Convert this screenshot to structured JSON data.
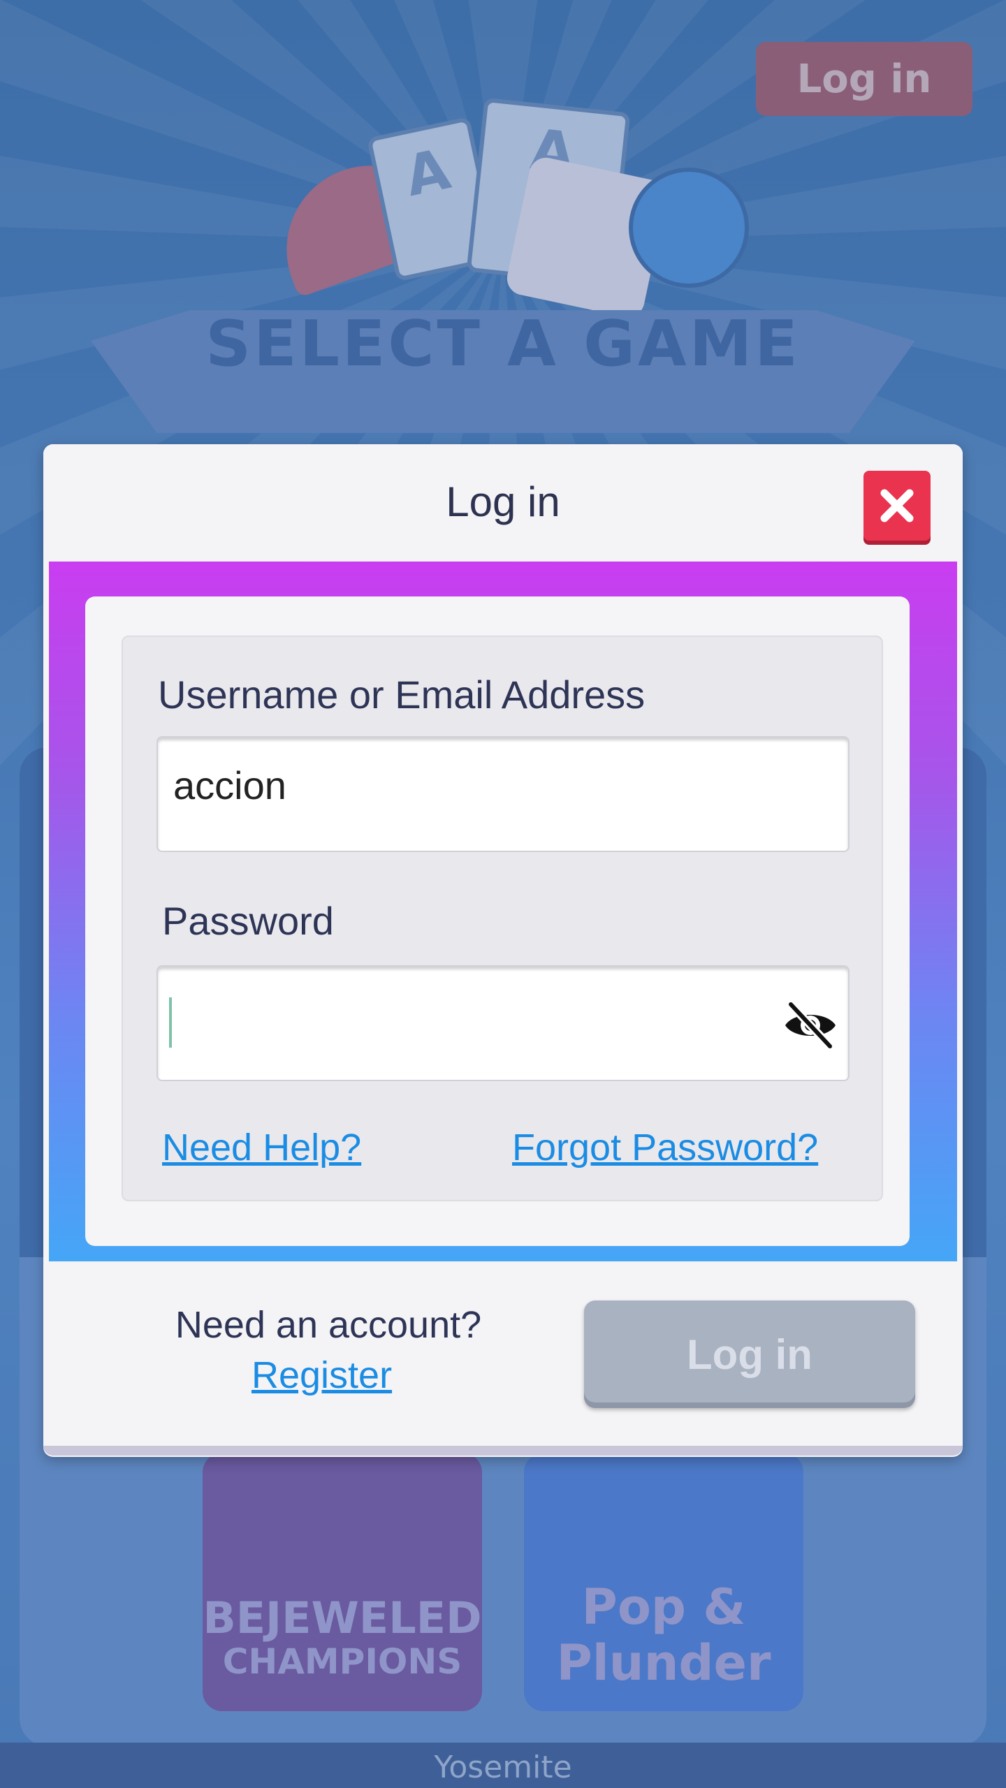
{
  "background": {
    "login_button_label": "Log in",
    "banner_title": "SELECT A GAME",
    "card_letter": "A",
    "games": [
      {
        "title_line1": "BEJEWELED",
        "title_line2": "CHAMPIONS"
      },
      {
        "title_line1": "Pop &",
        "title_line2": "Plunder"
      }
    ],
    "location_label": "Yosemite"
  },
  "modal": {
    "title": "Log in",
    "close_icon": "close-x-icon",
    "username": {
      "label": "Username or Email Address",
      "value": "accion"
    },
    "password": {
      "label": "Password",
      "value": "",
      "toggle_icon": "eye-slash-icon"
    },
    "links": {
      "help": "Need Help?",
      "forgot": "Forgot Password?"
    },
    "footer": {
      "prompt": "Need an account?",
      "register": "Register",
      "submit_label": "Log in"
    }
  },
  "colors": {
    "close_button": "#e9334f",
    "link": "#1b8ce3",
    "gradient_top": "#c93df0",
    "gradient_bottom": "#45a6f6",
    "submit_disabled": "#a9b2c1"
  }
}
